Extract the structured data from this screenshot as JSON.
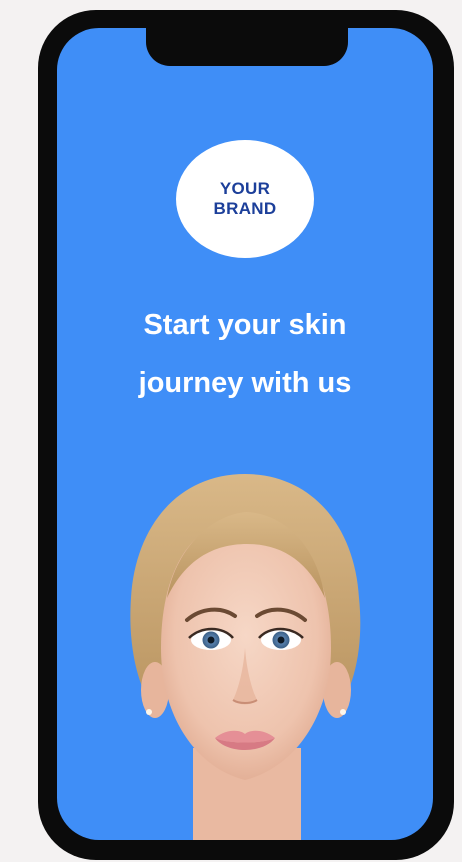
{
  "brand": {
    "line1": "YOUR",
    "line2": "BRAND"
  },
  "headline": {
    "line1": "Start your skin",
    "line2": "journey with us"
  },
  "colors": {
    "screen_background": "#3f8ef7",
    "brand_text": "#1c3f9a",
    "phone_frame": "#0b0b0b",
    "page_background": "#f4f2f2"
  },
  "illustration": {
    "icon": "woman-face-portrait"
  }
}
